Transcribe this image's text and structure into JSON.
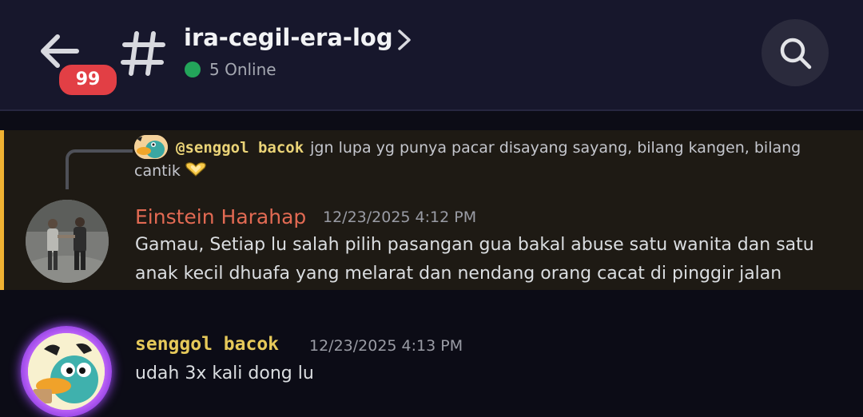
{
  "header": {
    "unread_badge": "99",
    "channel_name": "ira-cegil-era-log",
    "online_status": "5 Online",
    "colors": {
      "online": "#23a55a",
      "badge": "#e23f45"
    }
  },
  "icons": {
    "back": "arrow-left-icon",
    "channel": "hash-icon",
    "details": "chevron-right-icon",
    "search": "search-icon",
    "reply_emoji": "heart-hands-icon"
  },
  "messages": [
    {
      "reply": {
        "author": "@senggol bacok",
        "text": "jgn lupa yg punya pacar disayang sayang, bilang kangen, bilang cantik"
      },
      "author": "Einstein Harahap",
      "timestamp": "12/23/2025 4:12 PM",
      "text": "Gamau, Setiap lu salah pilih pasangan gua bakal abuse satu wanita dan satu anak kecil dhuafa yang melarat dan nendang orang cacat di pinggir jalan",
      "highlighted": true
    },
    {
      "author": "senggol bacok",
      "timestamp": "12/23/2025 4:13 PM",
      "text": "udah 3x kali dong lu"
    }
  ]
}
